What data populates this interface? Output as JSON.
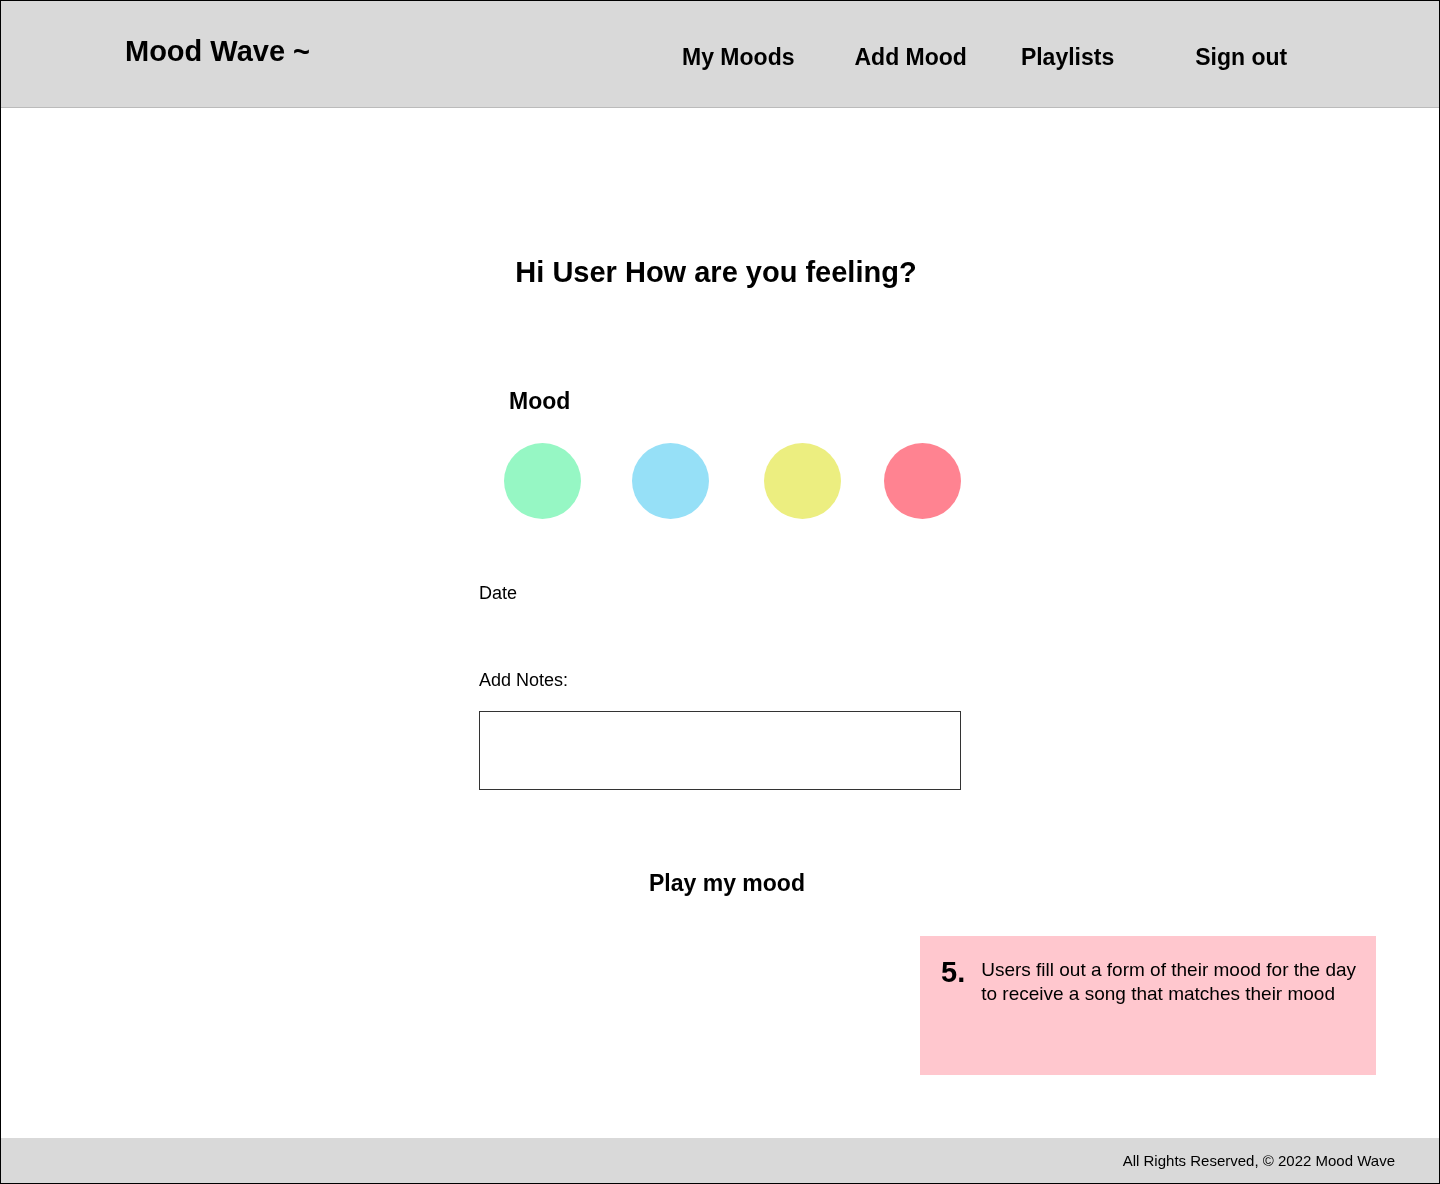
{
  "header": {
    "logo": "Mood Wave ~",
    "nav": [
      {
        "label": "My Moods"
      },
      {
        "label": "Add Mood"
      },
      {
        "label": "Playlists"
      },
      {
        "label": "Sign out"
      }
    ]
  },
  "form": {
    "heading": "Hi User How are you feeling?",
    "mood_label": "Mood",
    "moods": [
      {
        "color": "#96f7c4"
      },
      {
        "color": "#96e0f7"
      },
      {
        "color": "#ecee80"
      },
      {
        "color": "#ff8391"
      }
    ],
    "date_label": "Date",
    "notes_label": "Add Notes:",
    "submit": "Play my mood"
  },
  "note": {
    "number": "5.",
    "text": "Users fill out a form of their mood for the day to receive a song that matches their mood"
  },
  "footer": {
    "text": "All Rights Reserved, © 2022 Mood Wave"
  }
}
